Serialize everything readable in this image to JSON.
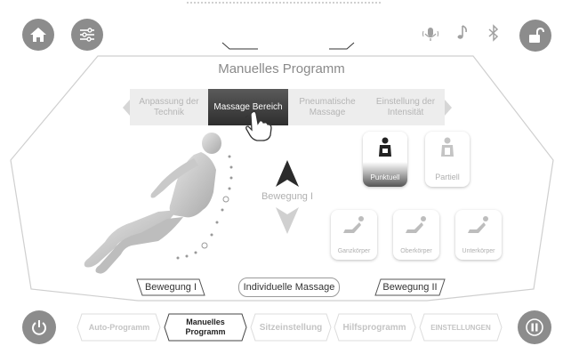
{
  "header": {
    "home_icon": "home-icon",
    "settings_icon": "sliders-icon",
    "mic_icon": "microphone-icon",
    "music_icon": "music-note-icon",
    "bluetooth_icon": "bluetooth-icon",
    "lock_icon": "unlock-icon"
  },
  "title": "Manuelles Programm",
  "tabs": [
    {
      "label": "Anpassung der Technik",
      "active": false
    },
    {
      "label": "Massage Bereich",
      "active": true
    },
    {
      "label": "Pneumatische Massage",
      "active": false
    },
    {
      "label": "Einstellung der Intensität",
      "active": false
    }
  ],
  "center": {
    "movement_label": "Bewegung I"
  },
  "modes": {
    "punktuell": "Punktuell",
    "partiell": "Partiell",
    "ganzkoerper": "Ganzkörper",
    "oberkoerper": "Oberkörper",
    "unterkoerper": "Unterkörper"
  },
  "bottom_labels": {
    "bewegung_1": "Bewegung I",
    "individuelle": "Individuelle Massage",
    "bewegung_2": "Bewegung II"
  },
  "nav": [
    {
      "label": "Auto-Programm",
      "active": false
    },
    {
      "label": "Manuelles Programm",
      "active": true
    },
    {
      "label": "Sitzeinstellung",
      "active": false
    },
    {
      "label": "Hilfsprogramm",
      "active": false
    },
    {
      "label": "EINSTELLUNGEN",
      "active": false
    }
  ],
  "colors": {
    "accent_dark": "#2e2e2e",
    "icon_grey": "#8c8c8c",
    "disabled": "#c4c4c4"
  }
}
